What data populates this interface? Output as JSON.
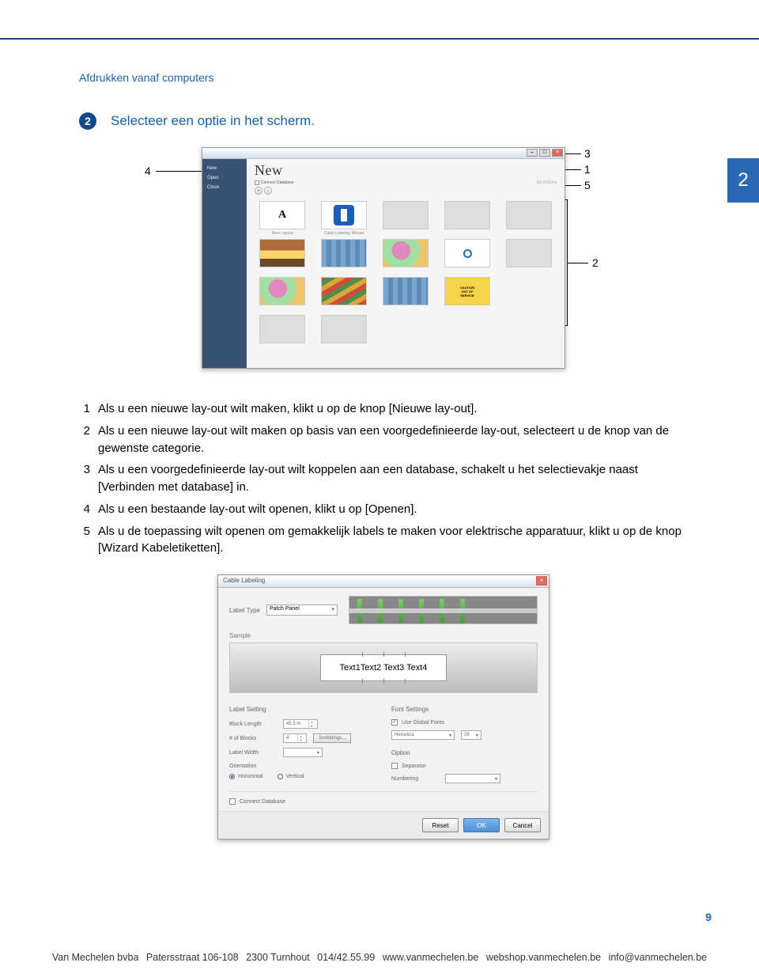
{
  "header_section": "Afdrukken vanaf computers",
  "step": {
    "number": "2",
    "text": "Selecteer een optie in het scherm."
  },
  "side_tab": "2",
  "callouts": {
    "c1": "1",
    "c2": "2",
    "c3": "3",
    "c4": "4",
    "c5": "5"
  },
  "app_window": {
    "sidebar": [
      "New",
      "Open",
      "Close"
    ],
    "new_title": "New",
    "connect_database": "Connect Database",
    "template_labels": [
      "New Layout",
      "Cable Labeling Wizard",
      "",
      "",
      ""
    ]
  },
  "instructions": [
    {
      "n": "1",
      "t": "Als u een nieuwe lay-out wilt maken, klikt u op de knop [Nieuwe lay-out]."
    },
    {
      "n": "2",
      "t": "Als u een nieuwe lay-out wilt maken op basis van een voorgedefinieerde lay-out, selecteert u de knop van de gewenste categorie."
    },
    {
      "n": "3",
      "t": "Als u een voorgedefinieerde lay-out wilt koppelen aan een database, schakelt u het selectievakje naast [Verbinden met database] in."
    },
    {
      "n": "4",
      "t": "Als u een bestaande lay-out wilt openen, klikt u op [Openen]."
    },
    {
      "n": "5",
      "t": "Als u de toepassing wilt openen om gemakkelijk labels te maken voor elektrische apparatuur, klikt u op de knop [Wizard Kabeletiketten]."
    }
  ],
  "dialog": {
    "title": "Cable Labeling",
    "label_type_lbl": "Label Type",
    "label_type_val": "Patch Panel",
    "sample_head": "Sample",
    "sample_text": "Text1Text2 Text3 Text4",
    "label_setting_head": "Label Setting",
    "block_length_lbl": "Block Length",
    "block_length_val": "45.5 m",
    "blocks_lbl": "# of Blocks",
    "blocks_val": "4",
    "spotlight_btn": "Scribblings...",
    "label_width_lbl": "Label Width",
    "orientation_lbl": "Orientation",
    "orient_h": "Horizontal",
    "orient_v": "Vertical",
    "font_head": "Font Settings",
    "use_font": "Use Global Fonts",
    "font_name": "Helvetica",
    "font_size": "28",
    "option_head": "Option",
    "separator": "Separator",
    "numbering": "Numbering",
    "connect_db": "Connect Database",
    "btn_reset": "Reset",
    "btn_ok": "OK",
    "btn_cancel": "Cancel"
  },
  "page_number": "9",
  "footer": {
    "company": "Van Mechelen bvba",
    "address": "Patersstraat 106-108",
    "city": "2300 Turnhout",
    "phone": "014/42.55.99",
    "www": "www.vanmechelen.be",
    "shop": "webshop.vanmechelen.be",
    "email": "info@vanmechelen.be"
  }
}
